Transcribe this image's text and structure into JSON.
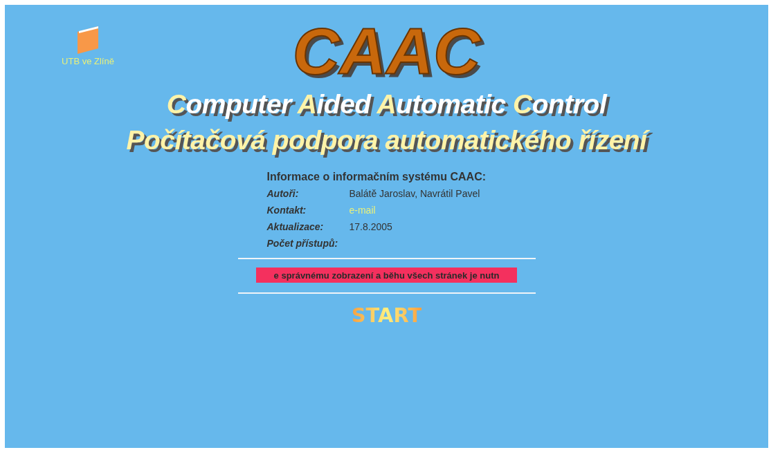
{
  "logo": {
    "caption": "UTB ve Zlíně"
  },
  "title": "CAAC",
  "subtitle_en": "Computer Aided Automatic Control",
  "subtitle_cz": "Počítačová podpora automatického řízení",
  "info": {
    "heading": "Informace o informačním systému CAAC:",
    "rows": [
      {
        "label": "Autoři:",
        "value": "Balátě Jaroslav, Navrátil Pavel",
        "kind": "text"
      },
      {
        "label": "Kontakt:",
        "value": "e-mail",
        "kind": "link"
      },
      {
        "label": "Aktualizace:",
        "value": "17.8.2005",
        "kind": "text"
      },
      {
        "label": "Počet přístupů:"
      }
    ]
  },
  "notice": "e správnému zobrazení a běhu všech stránek je nutn",
  "start": "START"
}
